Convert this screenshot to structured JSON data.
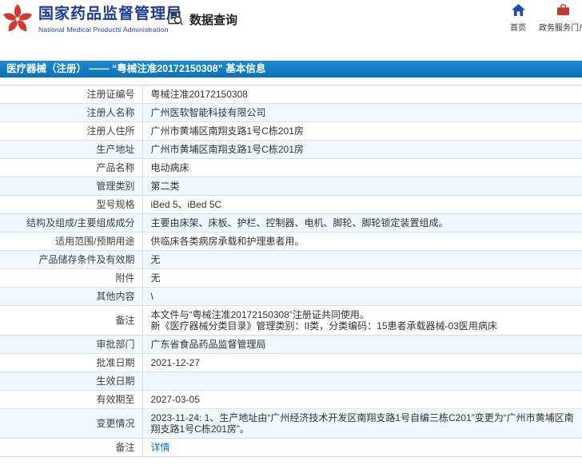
{
  "colors": {
    "brand_blue": "#1d3d92",
    "accent_blue": "#0b72b9",
    "link_blue": "#0a6cd6",
    "emblem_red": "#d2382c",
    "portal_red": "#c23a2f"
  },
  "header": {
    "org_name_cn": "国家药品监督管理局",
    "org_name_en": "National Medical Products Administration",
    "nav_query": "数据查询",
    "nav_home": "首页",
    "nav_portal": "政务服务门户"
  },
  "title_bar": {
    "text": "医疗器械（注册） ——  “粤械注准20172150308” 基本信息"
  },
  "table": {
    "rows": [
      {
        "label": "注册证编号",
        "value": "粤械注准20172150308"
      },
      {
        "label": "注册人名称",
        "value": "广州医软智能科技有限公司"
      },
      {
        "label": "注册人住所",
        "value": "广州市黄埔区南翔支路1号C栋201房"
      },
      {
        "label": "生产地址",
        "value": "广州市黄埔区南翔支路1号C栋201房"
      },
      {
        "label": "产品名称",
        "value": "电动病床"
      },
      {
        "label": "管理类别",
        "value": "第二类"
      },
      {
        "label": "型号规格",
        "value": "iBed 5、iBed 5C"
      },
      {
        "label": "结构及组成/主要组成成分",
        "value": "主要由床架、床板、护栏、控制器、电机、脚轮、脚轮锁定装置组成。"
      },
      {
        "label": "适用范围/预期用途",
        "value": "供临床各类病房承载和护理患者用。"
      },
      {
        "label": "产品储存条件及有效期",
        "value": "无"
      },
      {
        "label": "附件",
        "value": "无"
      },
      {
        "label": "其他内容",
        "value": "\\"
      },
      {
        "label": "备注",
        "value": "本文件与“粤械注准20172150308”注册证共同使用。\n新《医疗器械分类目录》管理类别：II类，分类编码：15患者承载器械-03医用病床"
      },
      {
        "label": "审批部门",
        "value": "广东省食品药品监督管理局"
      },
      {
        "label": "批准日期",
        "value": "2021-12-27"
      },
      {
        "label": "生效日期",
        "value": ""
      },
      {
        "label": "有效期至",
        "value": "2027-03-05"
      },
      {
        "label": "变更情况",
        "value": "2023-11-24: 1、生产地址由“广州经济技术开发区南翔支路1号自编三栋C201”变更为“广州市黄埔区南翔支路1号C栋201房”。"
      },
      {
        "label": "备注",
        "value": "详情",
        "is_link": true
      }
    ]
  }
}
